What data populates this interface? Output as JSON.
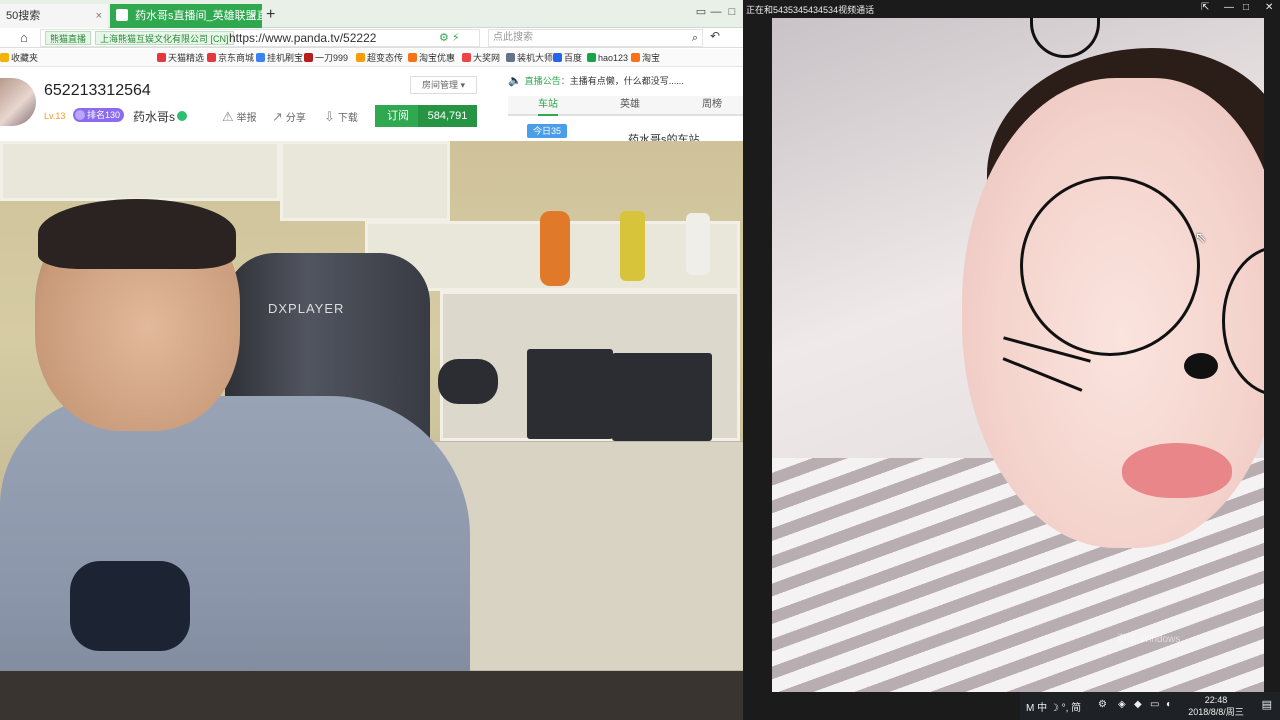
{
  "browser": {
    "tabs": [
      {
        "label": "50搜索",
        "close": "×"
      },
      {
        "label": "药水哥s直播间_英雄联盟直播",
        "close": "×"
      }
    ],
    "new_tab": "+",
    "address": {
      "badge_left": "熊猫直播",
      "badge_company": "上海熊猫互娱文化有限公司 [CN]",
      "url": "https://www.panda.tv/52222"
    },
    "search_placeholder": "点此搜索",
    "bookmarks": [
      {
        "label": "收藏夹",
        "color": "#f3b300"
      },
      {
        "label": "天猫精选",
        "color": "#e4393c"
      },
      {
        "label": "京东商城",
        "color": "#e4393c"
      },
      {
        "label": "挂机刷宝",
        "color": "#3b82f6"
      },
      {
        "label": "一刀999",
        "color": "#b91c1c"
      },
      {
        "label": "超变态传",
        "color": "#f59e0b"
      },
      {
        "label": "淘宝优惠",
        "color": "#f97316"
      },
      {
        "label": "大奖网",
        "color": "#ef4444"
      },
      {
        "label": "装机大师",
        "color": "#64748b"
      },
      {
        "label": "百度",
        "color": "#2563eb"
      },
      {
        "label": "hao123",
        "color": "#16a34a"
      },
      {
        "label": "淘宝",
        "color": "#f97316"
      }
    ]
  },
  "room": {
    "title": "652213312564",
    "level": "Lv.13",
    "rank": "排名130",
    "host": "药水哥s",
    "actions": [
      "举报",
      "分享",
      "下载"
    ],
    "manage": "房间管理",
    "subscribe_label": "订阅",
    "subscribe_count": "584,791",
    "notice_label": "直播公告：",
    "notice_text": "主播有点懒，什么都没写......",
    "tabs": [
      "车站",
      "英雄",
      "周榜"
    ],
    "today": "今日35",
    "station": "药水哥s的车站"
  },
  "camera": {
    "chair_brand": "DXPLAYER"
  },
  "call": {
    "title": "正在和5435345434534视频通话",
    "watermark": "激活 Windows"
  },
  "tray": {
    "ime": "M 中 ☽ °, 简",
    "time": "22:48",
    "date": "2018/8/8/周三"
  }
}
